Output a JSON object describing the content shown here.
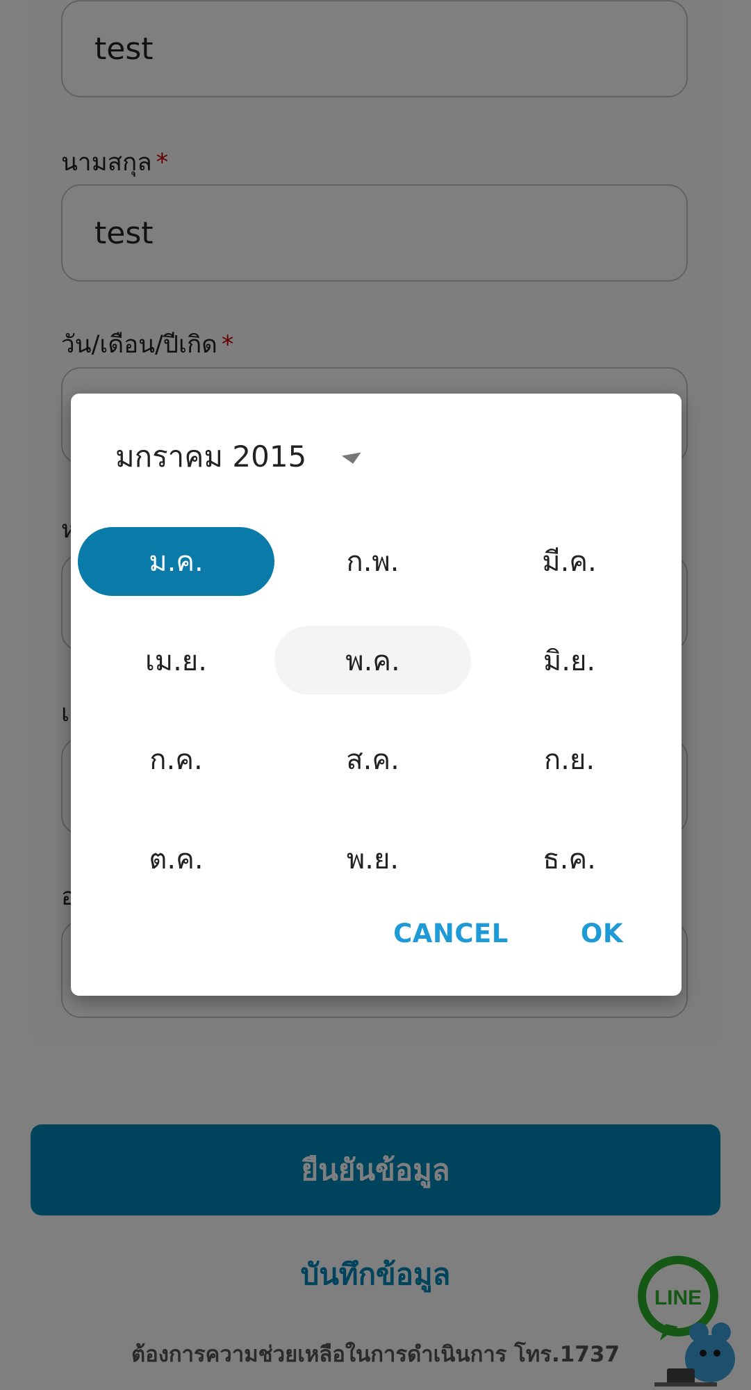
{
  "form": {
    "first_name_value": "test",
    "last_name_label": "นามสกุล",
    "last_name_value": "test",
    "dob_label": "วัน/เดือน/ปีเกิด",
    "required_mark": "*",
    "partial_labels": [
      "ห",
      "เ",
      "อ"
    ]
  },
  "datepicker": {
    "header": "มกราคม 2015",
    "months": [
      "ม.ค.",
      "ก.พ.",
      "มี.ค.",
      "เม.ย.",
      "พ.ค.",
      "มิ.ย.",
      "ก.ค.",
      "ส.ค.",
      "ก.ย.",
      "ต.ค.",
      "พ.ย.",
      "ธ.ค."
    ],
    "selected_month": "ม.ค.",
    "highlighted_month": "พ.ค.",
    "cancel_label": "CANCEL",
    "ok_label": "OK"
  },
  "actions": {
    "confirm_label": "ยืนยันข้อมูล",
    "save_label": "บันทึกข้อมูล",
    "help_text": "ต้องการความช่วยเหลือในการดำเนินการ โทร.1737"
  },
  "line_fab": {
    "label": "LINE",
    "color": "#2bb12b"
  },
  "colors": {
    "primary": "#0086b8",
    "selected_month": "#0a7aa8",
    "dialog_button": "#1e9bd7"
  }
}
